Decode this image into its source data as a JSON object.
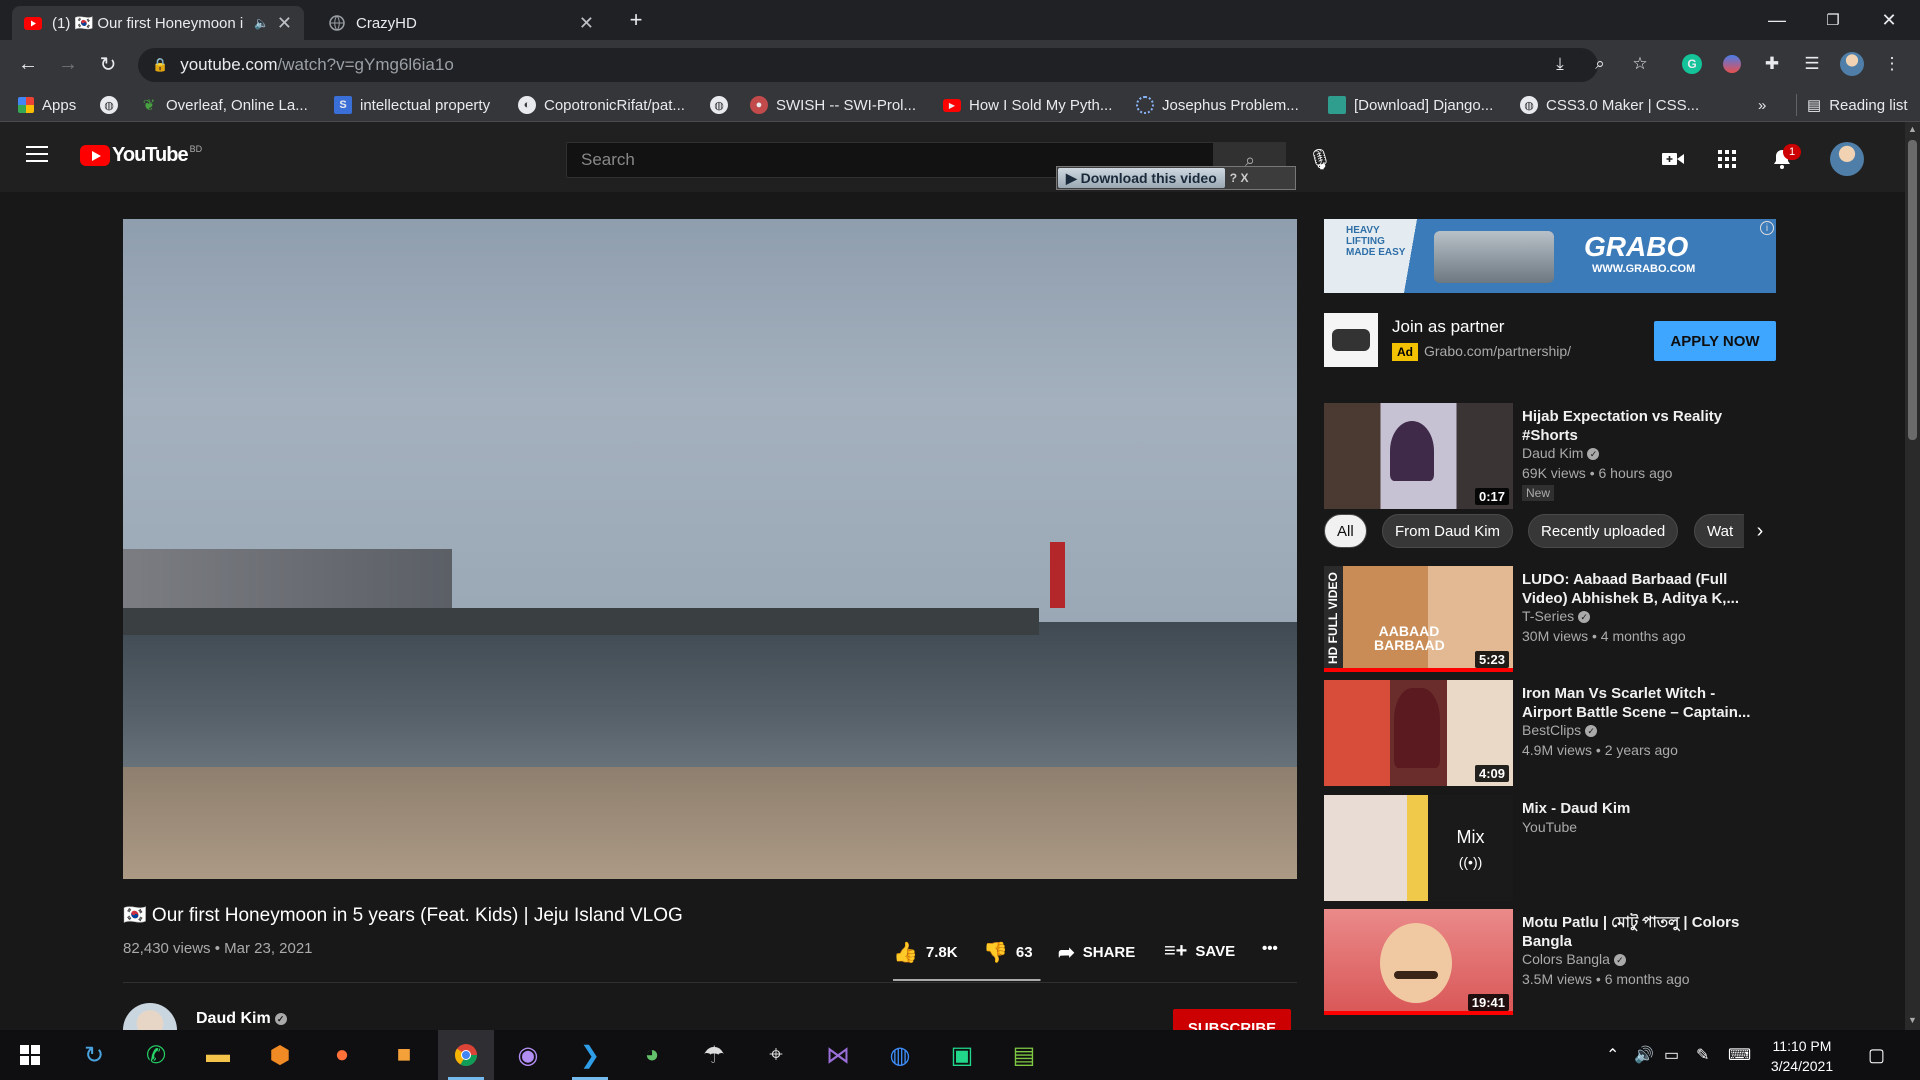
{
  "browser": {
    "tabs": [
      {
        "title": "(1) 🇰🇷 Our first Honeymoon i",
        "favicon": "youtube-icon",
        "active": true
      },
      {
        "title": "CrazyHD",
        "favicon": "globe-icon",
        "active": false
      }
    ],
    "url_domain": "youtube.com",
    "url_path": "/watch?v=gYmg6l6ia1o",
    "bookmarks": [
      {
        "label": "Apps",
        "icon": "apps-icon"
      },
      {
        "label": "",
        "icon": "globe-icon"
      },
      {
        "label": "Overleaf, Online La...",
        "icon": "overleaf-icon"
      },
      {
        "label": "intellectual property",
        "icon": "bookmark-icon"
      },
      {
        "label": "CopotronicRifat/pat...",
        "icon": "github-icon"
      },
      {
        "label": "",
        "icon": "globe-icon"
      },
      {
        "label": "SWISH -- SWI-Prol...",
        "icon": "swish-icon"
      },
      {
        "label": "How I Sold My Pyth...",
        "icon": "youtube-icon"
      },
      {
        "label": "Josephus Problem...",
        "icon": "loading-icon"
      },
      {
        "label": "[Download] Django...",
        "icon": "download-site-icon"
      },
      {
        "label": "CSS3.0 Maker | CSS...",
        "icon": "globe-icon"
      }
    ],
    "overflow": "»",
    "reading_list": "Reading list"
  },
  "youtube": {
    "logo_text": "YouTube",
    "country_code": "BD",
    "search_placeholder": "Search",
    "download_label": "▶ Download this video",
    "download_extra": "? X",
    "notification_count": "1"
  },
  "video": {
    "title": "🇰🇷 Our first Honeymoon in 5 years (Feat. Kids) | Jeju Island VLOG",
    "meta": "82,430 views • Mar 23, 2021",
    "likes": "7.8K",
    "dislikes": "63",
    "share_label": "SHARE",
    "save_label": "SAVE",
    "more_label": "•••",
    "like_ratio": 0.99,
    "channel": "Daud Kim",
    "subscribe_label": "SUBSCRIBE"
  },
  "ad": {
    "brand": "GRABO",
    "banner_tag": "HEAVY LIFTING MADE EASY",
    "banner_url": "WWW.GRABO.COM",
    "title": "Join as partner",
    "badge": "Ad",
    "url": "Grabo.com/partnership/",
    "cta": "APPLY NOW"
  },
  "chips": [
    "All",
    "From Daud Kim",
    "Recently uploaded",
    "Wat"
  ],
  "recommendations": [
    {
      "title": "Hijab Expectation vs Reality #Shorts",
      "channel": "Daud Kim",
      "verified": true,
      "views": "69K views • 6 hours ago",
      "badge": "New",
      "duration": "0:17"
    },
    {
      "title": "LUDO: Aabaad Barbaad (Full Video) Abhishek B, Aditya K,...",
      "channel": "T-Series",
      "verified": true,
      "views": "30M views • 4 months ago",
      "duration": "5:23",
      "thumb_text": "AABAAD BARBAAD",
      "side_text": "HD FULL VIDEO"
    },
    {
      "title": "Iron Man Vs Scarlet Witch - Airport Battle Scene – Captain...",
      "channel": "BestClips",
      "verified": true,
      "views": "4.9M views • 2 years ago",
      "duration": "4:09"
    },
    {
      "title": "Mix - Daud Kim",
      "channel": "YouTube",
      "verified": false,
      "views": "",
      "duration": "",
      "mix_label": "Mix",
      "mix_icon": "((•))"
    },
    {
      "title": "Motu Patlu | মোটু পাতলু | Colors Bangla",
      "channel": "Colors Bangla",
      "verified": true,
      "views": "3.5M views • 6 months ago",
      "duration": "19:41"
    }
  ],
  "taskbar": {
    "apps": [
      "windows-start-icon",
      "update-icon",
      "whatsapp-icon",
      "file-explorer-icon",
      "brave-icon",
      "firefox-icon",
      "app-orange-icon",
      "chrome-icon",
      "github-desktop-icon",
      "vscode-icon",
      "globe-app-icon",
      "parachute-icon",
      "satellite-icon",
      "visual-studio-icon",
      "messenger-icon",
      "pycharm-icon",
      "notepad-icon"
    ],
    "time": "11:10 PM",
    "date": "3/24/2021"
  }
}
